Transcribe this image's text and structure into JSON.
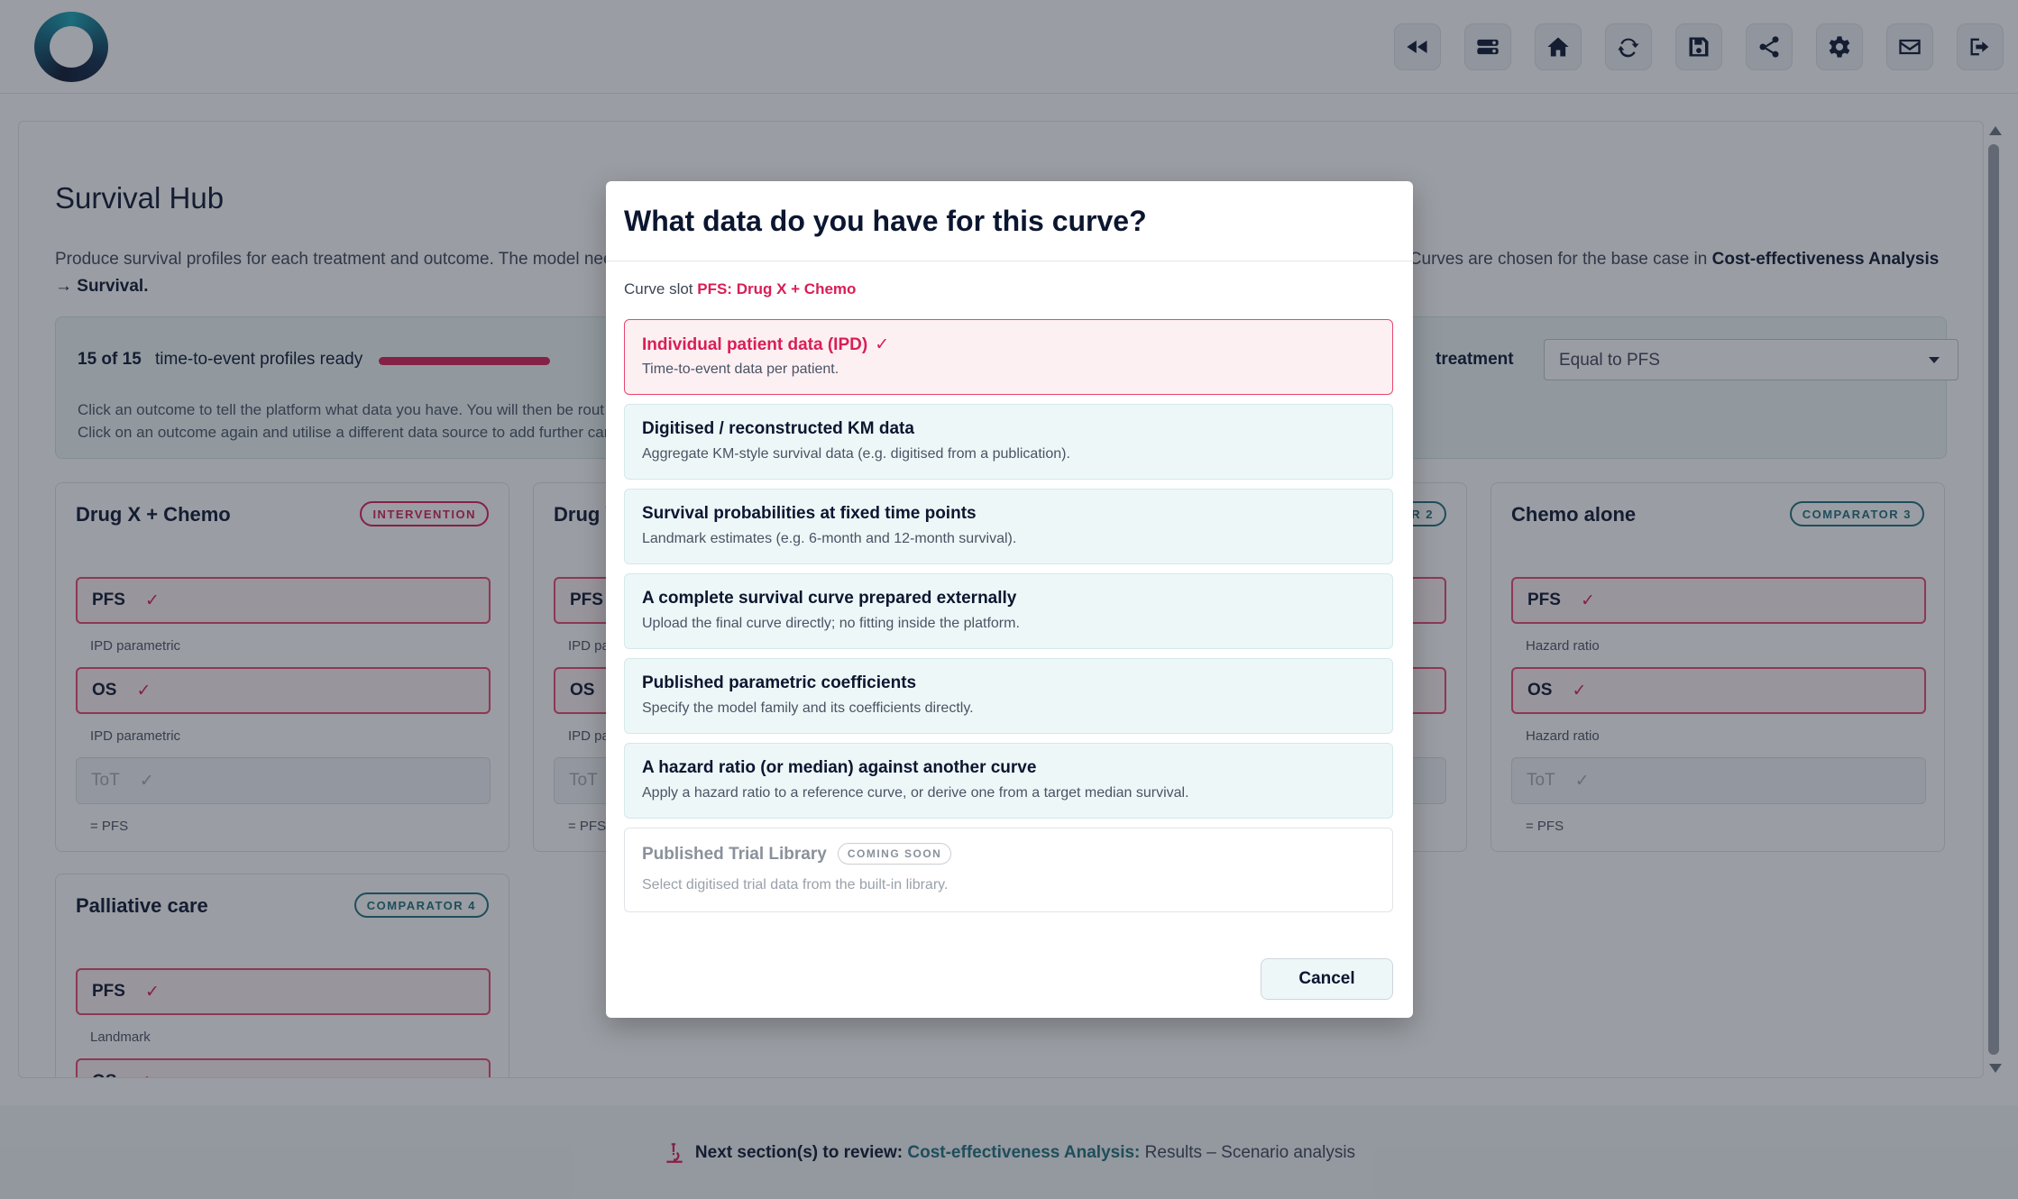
{
  "toolbar": {
    "icons": [
      "rewind-icon",
      "toggle-icon",
      "home-icon",
      "refresh-icon",
      "save-icon",
      "share-icon",
      "gear-icon",
      "mail-icon",
      "logout-icon"
    ]
  },
  "page": {
    "title": "Survival Hub",
    "intro_start": "Produce survival profiles for each treatment and outcome. The model nee",
    "intro_end": "w. Curves are chosen for the base case in ",
    "intro_link": "Cost-effectiveness Analysis → Survival."
  },
  "status": {
    "count": "15 of 15",
    "label": "time-to-event profiles ready",
    "progress": 1.0,
    "note_line1": "Click an outcome to tell the platform what data you have. You will then be rout",
    "note_line2": "Click on an outcome again and utilise a different data source to add further car",
    "tot_label": "treatment",
    "tot_selected": "Equal to PFS"
  },
  "cards": [
    {
      "title": "Drug X + Chemo",
      "badge": "INTERVENTION",
      "outcomes": [
        {
          "name": "PFS",
          "check": "✓",
          "sub": "IPD parametric"
        },
        {
          "name": "OS",
          "check": "✓",
          "sub": "IPD parametric"
        },
        {
          "name": "ToT",
          "check": "✓",
          "sub": "= PFS"
        }
      ]
    },
    {
      "title": "Drug Y",
      "badge": "R 2",
      "outcomes": [
        {
          "name": "PFS",
          "check": "",
          "sub": "IPD pa"
        },
        {
          "name": "OS",
          "check": "",
          "sub": "IPD pa"
        },
        {
          "name": "ToT",
          "check": "",
          "sub": "= PFS"
        }
      ]
    },
    {
      "title": "Chemo alone",
      "badge": "COMPARATOR 3",
      "outcomes": [
        {
          "name": "PFS",
          "check": "✓",
          "sub": "Hazard ratio"
        },
        {
          "name": "OS",
          "check": "✓",
          "sub": "Hazard ratio"
        },
        {
          "name": "ToT",
          "check": "✓",
          "sub": "= PFS"
        }
      ]
    },
    {
      "title": "Palliative care",
      "badge": "COMPARATOR 4",
      "outcomes": [
        {
          "name": "PFS",
          "check": "✓",
          "sub": "Landmark"
        },
        {
          "name": "OS",
          "check": "✓",
          "sub": ""
        }
      ]
    }
  ],
  "modal": {
    "title": "What data do you have for this curve?",
    "slot_label": "Curve slot ",
    "slot_name": "PFS: Drug X + Chemo",
    "options": [
      {
        "title": "Individual patient data (IPD)",
        "check": "✓",
        "desc": "Time-to-event data per patient."
      },
      {
        "title": "Digitised / reconstructed KM data",
        "desc": "Aggregate KM-style survival data (e.g. digitised from a publication)."
      },
      {
        "title": "Survival probabilities at fixed time points",
        "desc": "Landmark estimates (e.g. 6-month and 12-month survival)."
      },
      {
        "title": "A complete survival curve prepared externally",
        "desc": "Upload the final curve directly; no fitting inside the platform."
      },
      {
        "title": "Published parametric coefficients",
        "desc": "Specify the model family and its coefficients directly."
      },
      {
        "title": "A hazard ratio (or median) against another curve",
        "desc": "Apply a hazard ratio to a reference curve, or derive one from a target median survival."
      },
      {
        "title": "Published Trial Library",
        "badge": "COMING SOON",
        "desc": "Select digitised trial data from the built-in library."
      }
    ],
    "cancel_label": "Cancel"
  },
  "footer": {
    "prefix": "Next section(s) to review:",
    "section": "Cost-effectiveness Analysis:",
    "items": "Results – Scenario analysis"
  }
}
